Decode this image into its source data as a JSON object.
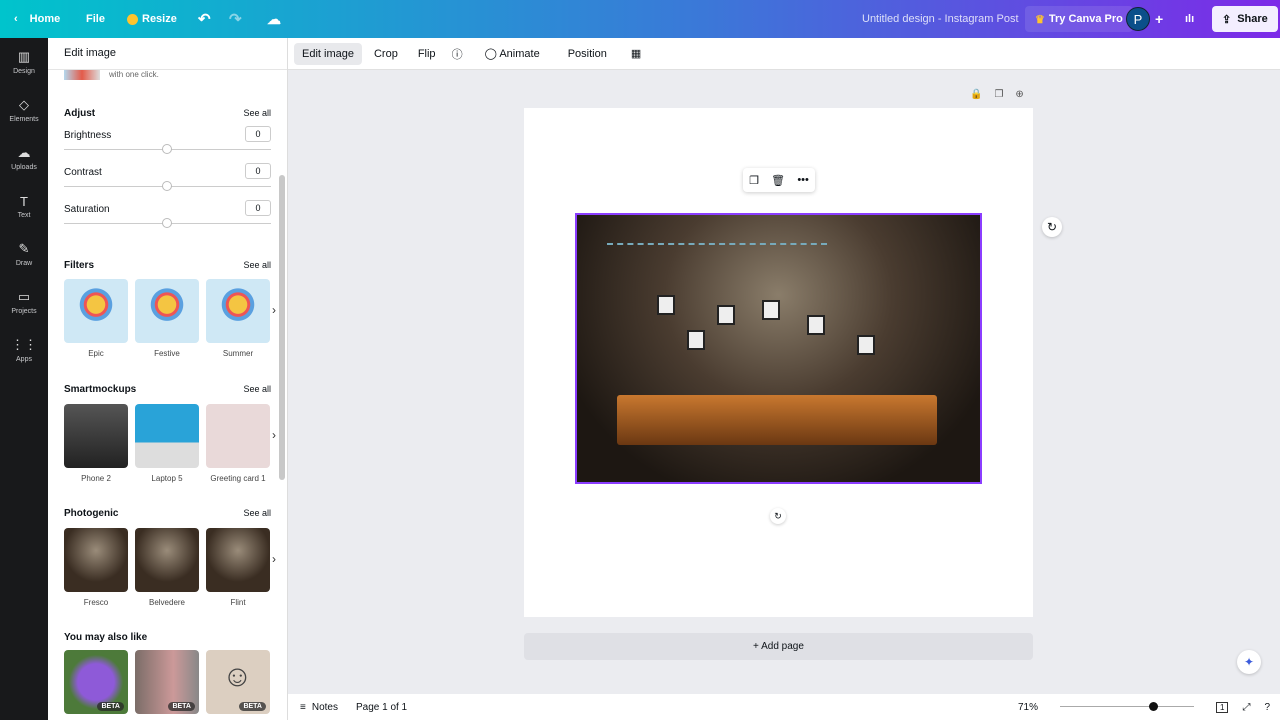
{
  "topbar": {
    "home": "Home",
    "file": "File",
    "resize": "Resize",
    "title": "Untitled design - Instagram Post",
    "try_pro": "Try Canva Pro",
    "avatar": "P",
    "share": "Share"
  },
  "rail": [
    {
      "label": "Design",
      "icon": "▥"
    },
    {
      "label": "Elements",
      "icon": "◇"
    },
    {
      "label": "Uploads",
      "icon": "☁"
    },
    {
      "label": "Text",
      "icon": "T"
    },
    {
      "label": "Draw",
      "icon": "✎"
    },
    {
      "label": "Projects",
      "icon": "▭"
    },
    {
      "label": "Apps",
      "icon": "⋮⋮"
    }
  ],
  "panel": {
    "title": "Edit image",
    "partial_text": "with one click.",
    "adjust": {
      "title": "Adjust",
      "see_all": "See all",
      "items": [
        {
          "label": "Brightness",
          "value": "0"
        },
        {
          "label": "Contrast",
          "value": "0"
        },
        {
          "label": "Saturation",
          "value": "0"
        }
      ]
    },
    "filters": {
      "title": "Filters",
      "see_all": "See all",
      "items": [
        "Epic",
        "Festive",
        "Summer"
      ]
    },
    "smartmockups": {
      "title": "Smartmockups",
      "see_all": "See all",
      "items": [
        "Phone 2",
        "Laptop 5",
        "Greeting card 1"
      ]
    },
    "photogenic": {
      "title": "Photogenic",
      "see_all": "See all",
      "items": [
        "Fresco",
        "Belvedere",
        "Flint"
      ]
    },
    "also_like": {
      "title": "You may also like",
      "badge": "BETA"
    }
  },
  "context": {
    "edit_image": "Edit image",
    "crop": "Crop",
    "flip": "Flip",
    "animate": "Animate",
    "position": "Position"
  },
  "canvas": {
    "add_page": "+ Add page"
  },
  "bottom": {
    "notes": "Notes",
    "page": "Page 1 of 1",
    "zoom": "71%",
    "zoom_value": 71,
    "page_count": "1"
  },
  "colors": {
    "accent": "#8b3dff"
  }
}
